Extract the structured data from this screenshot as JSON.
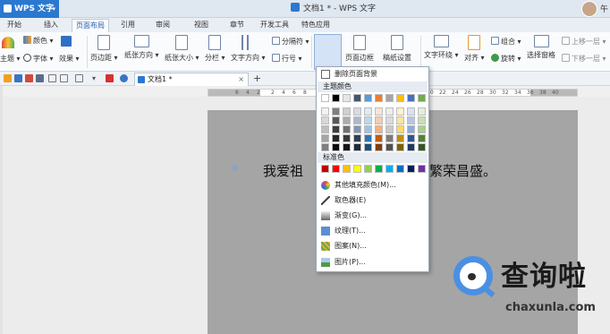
{
  "app": {
    "menu_label": "WPS 文字",
    "window_title": "文档1 * - WPS 文字",
    "user_label": "午"
  },
  "menu_tabs": [
    "开始",
    "插入",
    "页面布局",
    "引用",
    "审阅",
    "视图",
    "章节",
    "开发工具",
    "特色应用"
  ],
  "ribbon": {
    "theme": "主题",
    "colors": "颜色",
    "fonts": "字体",
    "effects": "效果",
    "margins": "页边距",
    "orientation": "纸张方向",
    "paper_direction": "纸张方向",
    "paper_size": "纸张大小",
    "columns": "分栏",
    "text_direction": "文字方向",
    "separator": "分隔符",
    "line_numbers": "行号",
    "background": "背景",
    "page_border": "页面边框",
    "manuscript": "稿纸设置",
    "text_wrap": "文字环绕",
    "align": "对齐",
    "group": "组合",
    "rotate": "旋转",
    "selection_pane": "选择窗格",
    "bring_forward": "上移一层",
    "send_backward": "下移一层"
  },
  "doc_tab": {
    "label": "文档1 *",
    "close": "×",
    "add": "+"
  },
  "ruler_numbers": [
    "6",
    "4",
    "2",
    "2",
    "4",
    "6",
    "8",
    "10",
    "12",
    "14",
    "16",
    "18",
    "20",
    "22",
    "24",
    "26",
    "28",
    "30",
    "32",
    "34",
    "36",
    "38",
    "40"
  ],
  "document": {
    "text_left": "我爱祖",
    "text_right": "繁荣昌盛。"
  },
  "dropdown": {
    "remove_background": "删除页面背景",
    "theme_colors_header": "主题颜色",
    "standard_colors_header": "标准色",
    "more_fill_colors": "其他填充颜色(M)...",
    "eyedropper": "取色器(E)",
    "gradient": "渐变(G)...",
    "texture": "纹理(T)...",
    "pattern": "图案(N)...",
    "picture": "图片(P)..."
  },
  "theme_colors_top": [
    "#ffffff",
    "#000000",
    "#e7e6e6",
    "#44546a",
    "#5b9bd5",
    "#ed7d31",
    "#a5a5a5",
    "#ffc000",
    "#4472c4",
    "#70ad47"
  ],
  "theme_color_shades": [
    [
      "#f2f2f2",
      "#7f7f7f",
      "#d0cece",
      "#d6dce4",
      "#deebf6",
      "#fbe5d5",
      "#ededed",
      "#fff2cc",
      "#d9e2f3",
      "#e2efd9"
    ],
    [
      "#d8d8d8",
      "#595959",
      "#aeabab",
      "#adb9ca",
      "#bdd7ee",
      "#f8cbad",
      "#dbdbdb",
      "#fee599",
      "#b4c6e7",
      "#c5e0b3"
    ],
    [
      "#bfbfbf",
      "#3f3f3f",
      "#757070",
      "#8496b0",
      "#9dc3e6",
      "#f4b183",
      "#c9c9c9",
      "#ffd965",
      "#8eaadb",
      "#a8d08d"
    ],
    [
      "#a5a5a5",
      "#262626",
      "#3a3838",
      "#323f4f",
      "#2e75b5",
      "#c55a11",
      "#7b7b7b",
      "#bf9000",
      "#2f5496",
      "#538135"
    ],
    [
      "#7f7f7f",
      "#0c0c0c",
      "#171616",
      "#222a35",
      "#1e4e79",
      "#833c0b",
      "#525252",
      "#7f6000",
      "#1f3864",
      "#375623"
    ]
  ],
  "standard_colors": [
    "#c00000",
    "#ff0000",
    "#ffc000",
    "#ffff00",
    "#92d050",
    "#00b050",
    "#00b0f0",
    "#0070c0",
    "#002060",
    "#7030a0"
  ],
  "watermark": {
    "title": "查询啦",
    "url": "chaxunla.com"
  }
}
